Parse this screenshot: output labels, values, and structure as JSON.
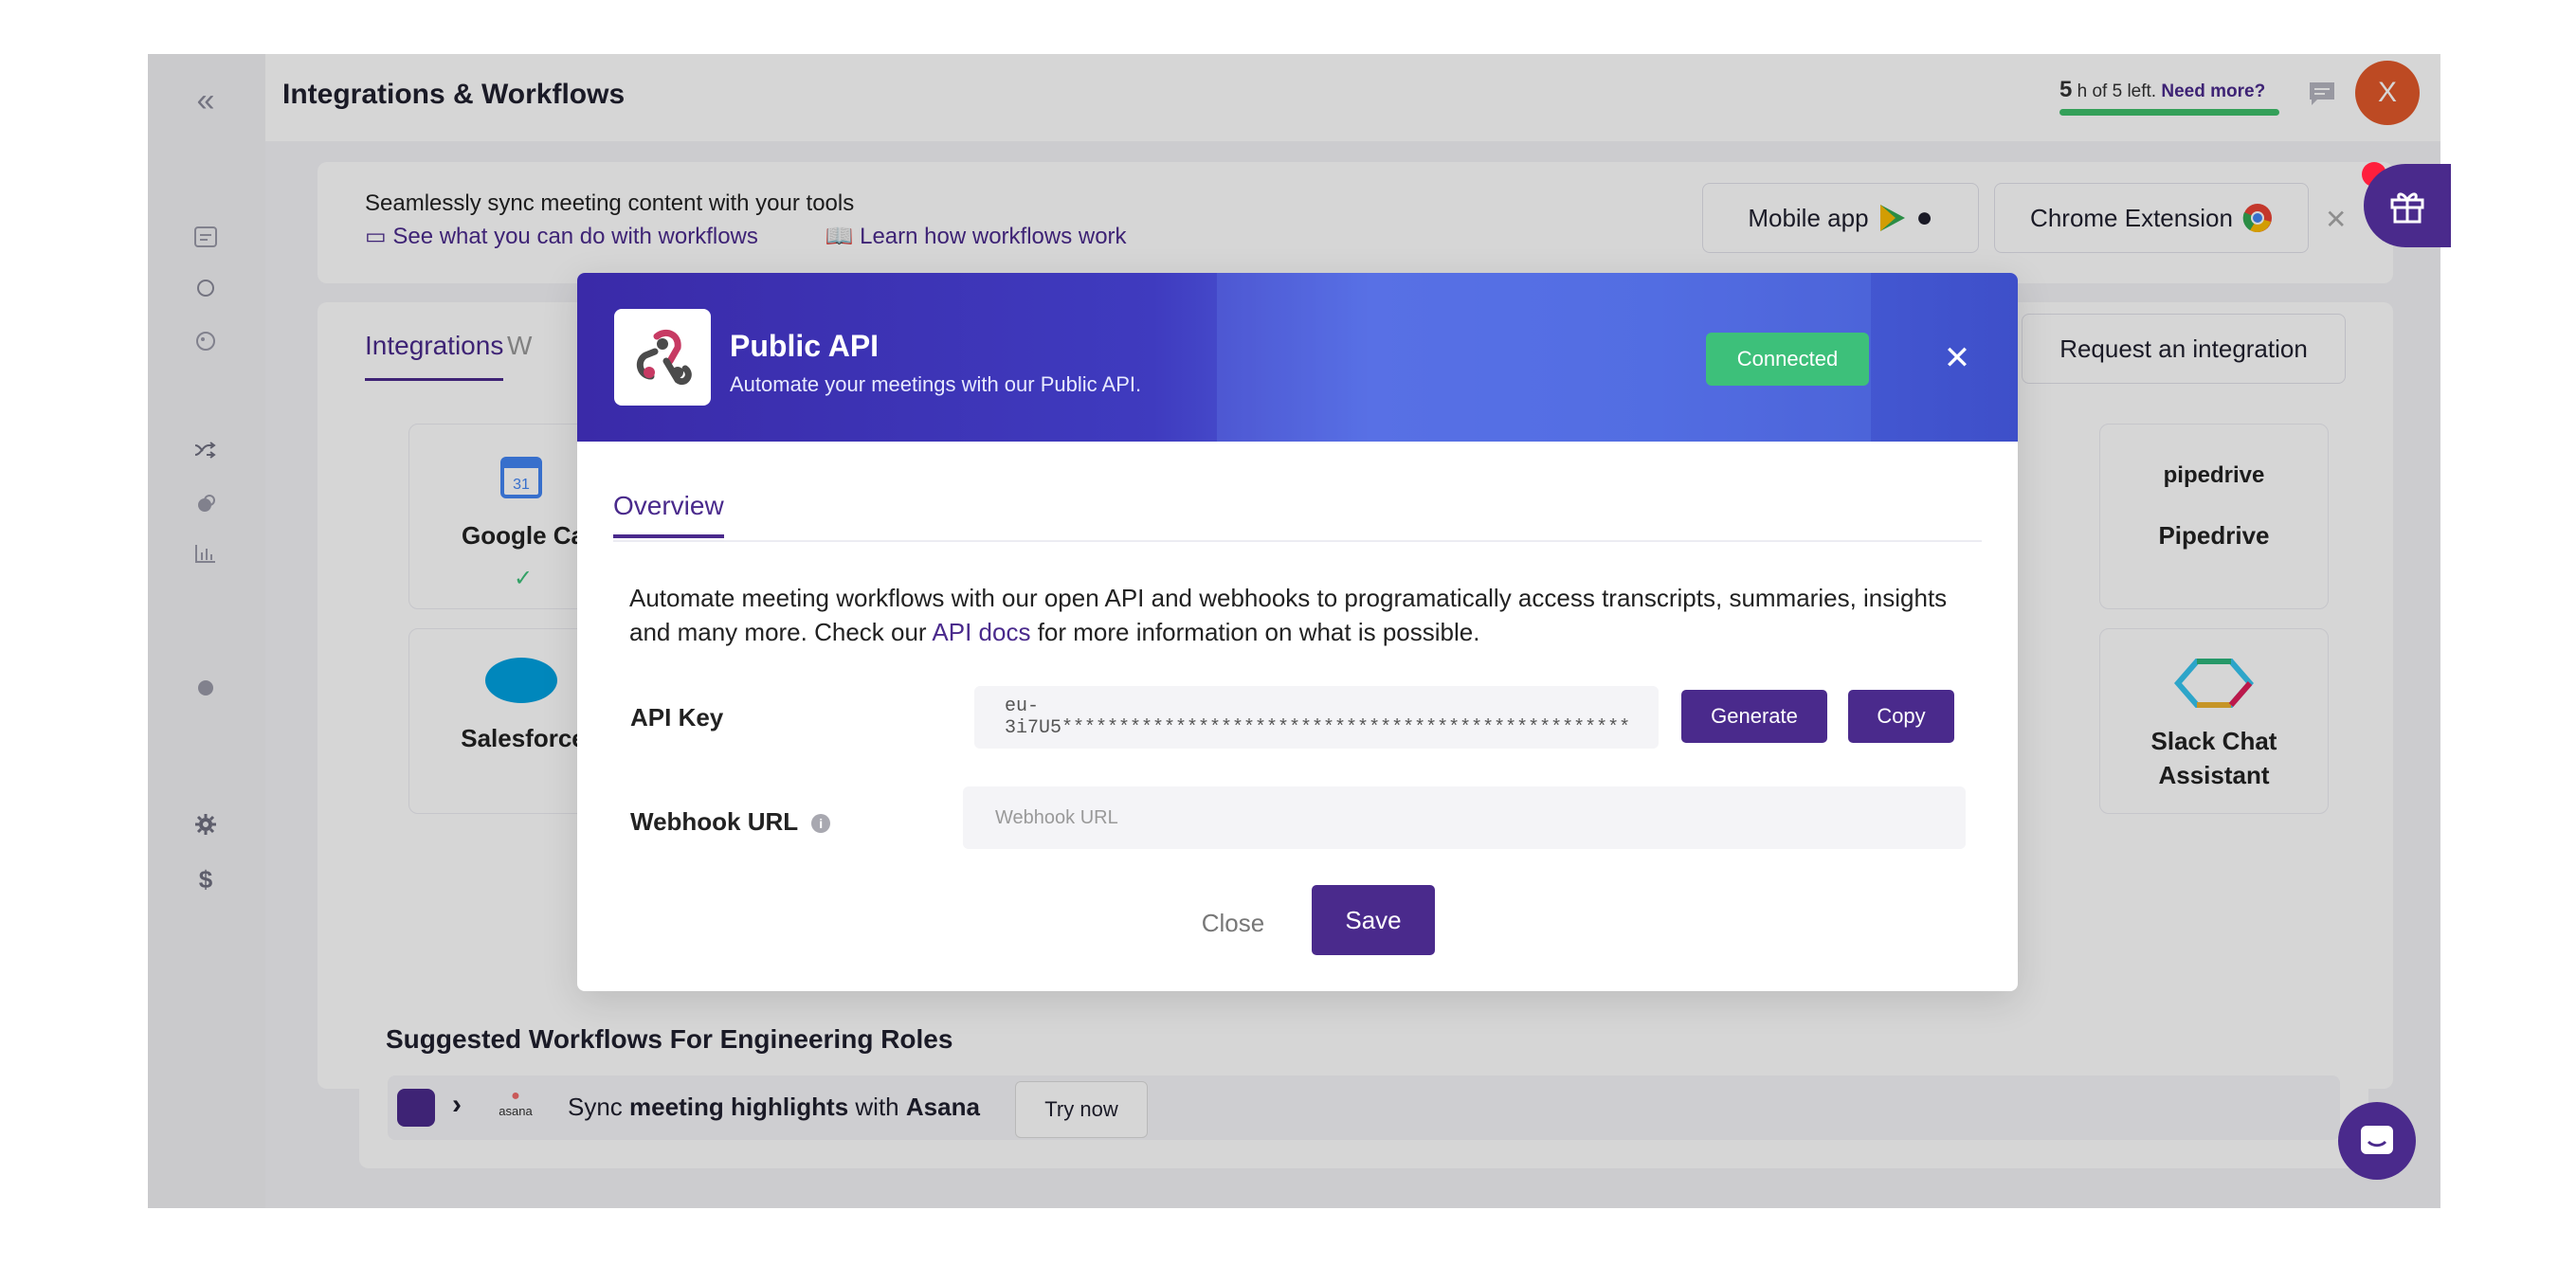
{
  "header": {
    "title": "Integrations & Workflows",
    "hours_count": "5",
    "hours_text": "h of 5 left.",
    "need_more": "Need more?",
    "avatar_initial": "X"
  },
  "banner": {
    "text": "Seamlessly sync meeting content with your tools",
    "link_see": "See what you can do with workflows",
    "link_learn": "Learn how workflows work",
    "mobile_app": "Mobile app",
    "chrome_extension": "Chrome Extension"
  },
  "integrations": {
    "tab_active": "Integrations",
    "tab_other": "W",
    "request_button": "Request an integration",
    "cards": {
      "google_calendar": "Google Ca",
      "salesforce": "Salesforce",
      "pipedrive": "Pipedrive",
      "pipedrive_logo": "pipedrive",
      "slack_line1": "Slack Chat",
      "slack_line2": "Assistant"
    }
  },
  "suggested": {
    "title": "Suggested Workflows For Engineering Roles",
    "row_prefix": "Sync",
    "row_bold1": "meeting highlights",
    "row_mid": "with",
    "row_bold2": "Asana",
    "try_now": "Try now",
    "asana_logo": "asana"
  },
  "modal": {
    "title": "Public API",
    "subtitle": "Automate your meetings with our Public API.",
    "status": "Connected",
    "tab": "Overview",
    "desc_part1": "Automate meeting workflows with our open API and webhooks to programatically access transcripts, summaries, insights and many more. Check our",
    "desc_link": "API docs",
    "desc_part2": "for more information on what is possible.",
    "api_key_label": "API Key",
    "api_key_value": "eu-3i7U5**************************************************",
    "generate": "Generate",
    "copy": "Copy",
    "webhook_label": "Webhook URL",
    "webhook_placeholder": "Webhook URL",
    "close": "Close",
    "save": "Save"
  },
  "colors": {
    "brand": "#4a2a8c",
    "connected": "#3dc07a",
    "avatar": "#e2592a"
  }
}
